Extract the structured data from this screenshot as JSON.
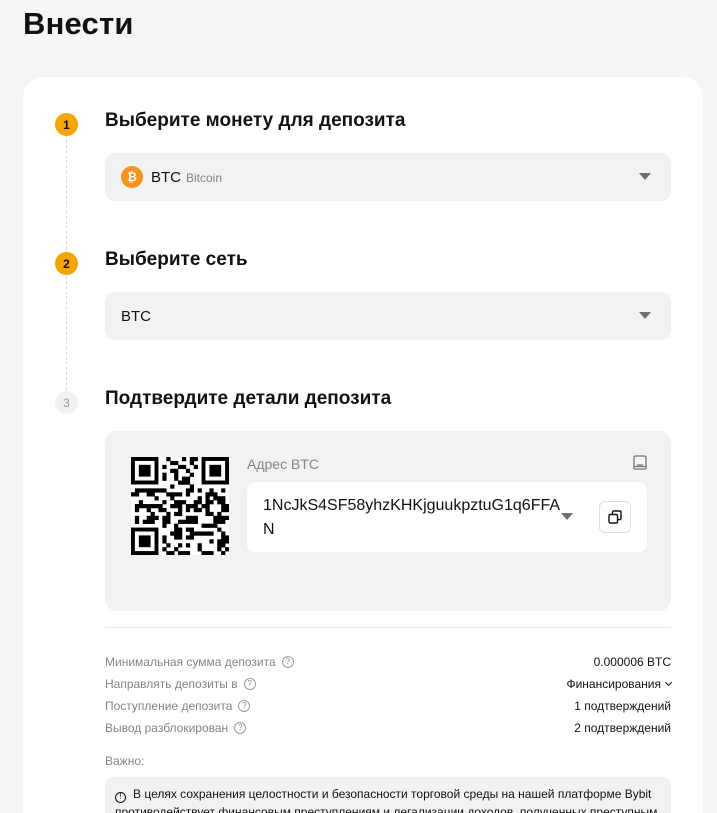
{
  "page": {
    "title": "Внести"
  },
  "steps": [
    {
      "number": "1",
      "title": "Выберите монету для депозита"
    },
    {
      "number": "2",
      "title": "Выберите сеть"
    },
    {
      "number": "3",
      "title": "Подтвердите детали депозита"
    }
  ],
  "coin_select": {
    "symbol": "BTC",
    "name": "Bitcoin",
    "icon_glyph": "₿",
    "icon_color": "#f7931a"
  },
  "network_select": {
    "value": "BTC"
  },
  "deposit": {
    "address_label": "Адрес BTC",
    "address": "1NcJkS4SF58yhzKHKjguukpztuG1q6FFAN"
  },
  "details": [
    {
      "label": "Минимальная сумма депозита",
      "value": "0.000006 BTC",
      "has_help": true,
      "has_dropdown": false
    },
    {
      "label": "Направлять депозиты в",
      "value": "Финансирования",
      "has_help": true,
      "has_dropdown": true
    },
    {
      "label": "Поступление депозита",
      "value": "1 подтверждений",
      "has_help": true,
      "has_dropdown": false
    },
    {
      "label": "Вывод разблокирован",
      "value": "2 подтверждений",
      "has_help": true,
      "has_dropdown": false
    }
  ],
  "important": {
    "label": "Важно:",
    "text": "В целях сохранения целостности и безопасности торговой среды на нашей платформе Bybit противодействует финансовым преступлениям и легализации доходов, полученных преступным путём."
  },
  "colors": {
    "accent": "#f7a600",
    "panel": "#f1f2f4",
    "text": "#121214",
    "muted": "#81858c"
  }
}
